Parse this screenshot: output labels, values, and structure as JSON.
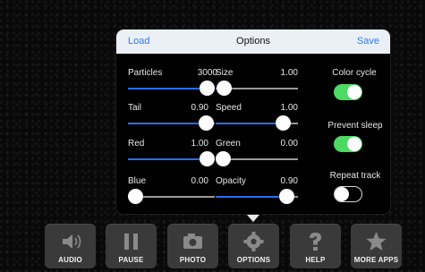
{
  "dialog": {
    "title": "Options",
    "load_label": "Load",
    "save_label": "Save"
  },
  "sliders": [
    {
      "label": "Particles",
      "value": "3000",
      "level": 0.92
    },
    {
      "label": "Size",
      "value": "1.00",
      "level": 0.1
    },
    {
      "label": "Tail",
      "value": "0.90",
      "level": 0.9
    },
    {
      "label": "Speed",
      "value": "1.00",
      "level": 0.82
    },
    {
      "label": "Red",
      "value": "1.00",
      "level": 0.96
    },
    {
      "label": "Green",
      "value": "0.00",
      "level": 0.02
    },
    {
      "label": "Blue",
      "value": "0.00",
      "level": 0.02
    },
    {
      "label": "Opacity",
      "value": "0.90",
      "level": 0.86
    }
  ],
  "toggles": [
    {
      "label": "Color cycle",
      "on": true
    },
    {
      "label": "Prevent sleep",
      "on": true
    },
    {
      "label": "Repeat track",
      "on": false
    }
  ],
  "toolbar": [
    {
      "label": "AUDIO",
      "icon": "speaker-icon"
    },
    {
      "label": "PAUSE",
      "icon": "pause-icon"
    },
    {
      "label": "PHOTO",
      "icon": "camera-icon"
    },
    {
      "label": "OPTIONS",
      "icon": "gear-icon"
    },
    {
      "label": "HELP",
      "icon": "question-icon"
    },
    {
      "label": "MORE APPS",
      "icon": "star-icon"
    }
  ],
  "colors": {
    "accent": "#2f7bf5",
    "slider_fill": "#2a6ef0",
    "toggle_on": "#4cd964"
  }
}
